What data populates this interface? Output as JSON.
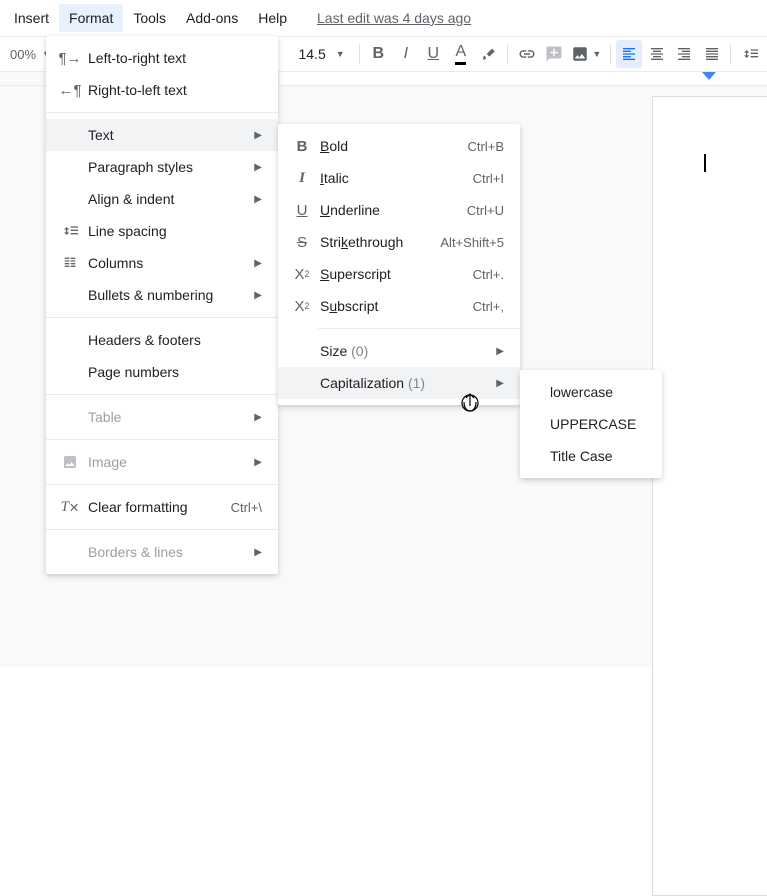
{
  "menubar": {
    "items": [
      "Insert",
      "Format",
      "Tools",
      "Add-ons",
      "Help"
    ],
    "active_index": 1,
    "last_edit": "Last edit was 4 days ago"
  },
  "toolbar": {
    "zoom": "00%",
    "fontsize": "14.5"
  },
  "menu_format": {
    "ltr": "Left-to-right text",
    "rtl": "Right-to-left text",
    "text": "Text",
    "paragraph_styles": "Paragraph styles",
    "align_indent": "Align & indent",
    "line_spacing": "Line spacing",
    "columns": "Columns",
    "bullets_numbering": "Bullets & numbering",
    "headers_footers": "Headers & footers",
    "page_numbers": "Page numbers",
    "table": "Table",
    "image": "Image",
    "clear_formatting": "Clear formatting",
    "clear_formatting_shortcut": "Ctrl+\\",
    "borders_lines": "Borders & lines"
  },
  "menu_text": {
    "bold": "Bold",
    "bold_sc": "Ctrl+B",
    "italic": "Italic",
    "italic_sc": "Ctrl+I",
    "underline": "Underline",
    "underline_sc": "Ctrl+U",
    "strikethrough": "Strikethrough",
    "strike_sc": "Alt+Shift+5",
    "superscript": "Superscript",
    "super_sc": "Ctrl+.",
    "subscript": "Subscript",
    "sub_sc": "Ctrl+,",
    "size": "Size",
    "size_paren": "(0)",
    "capitalization": "Capitalization",
    "cap_paren": "(1)"
  },
  "menu_cap": {
    "lowercase": "lowercase",
    "uppercase": "UPPERCASE",
    "titlecase": "Title Case"
  }
}
